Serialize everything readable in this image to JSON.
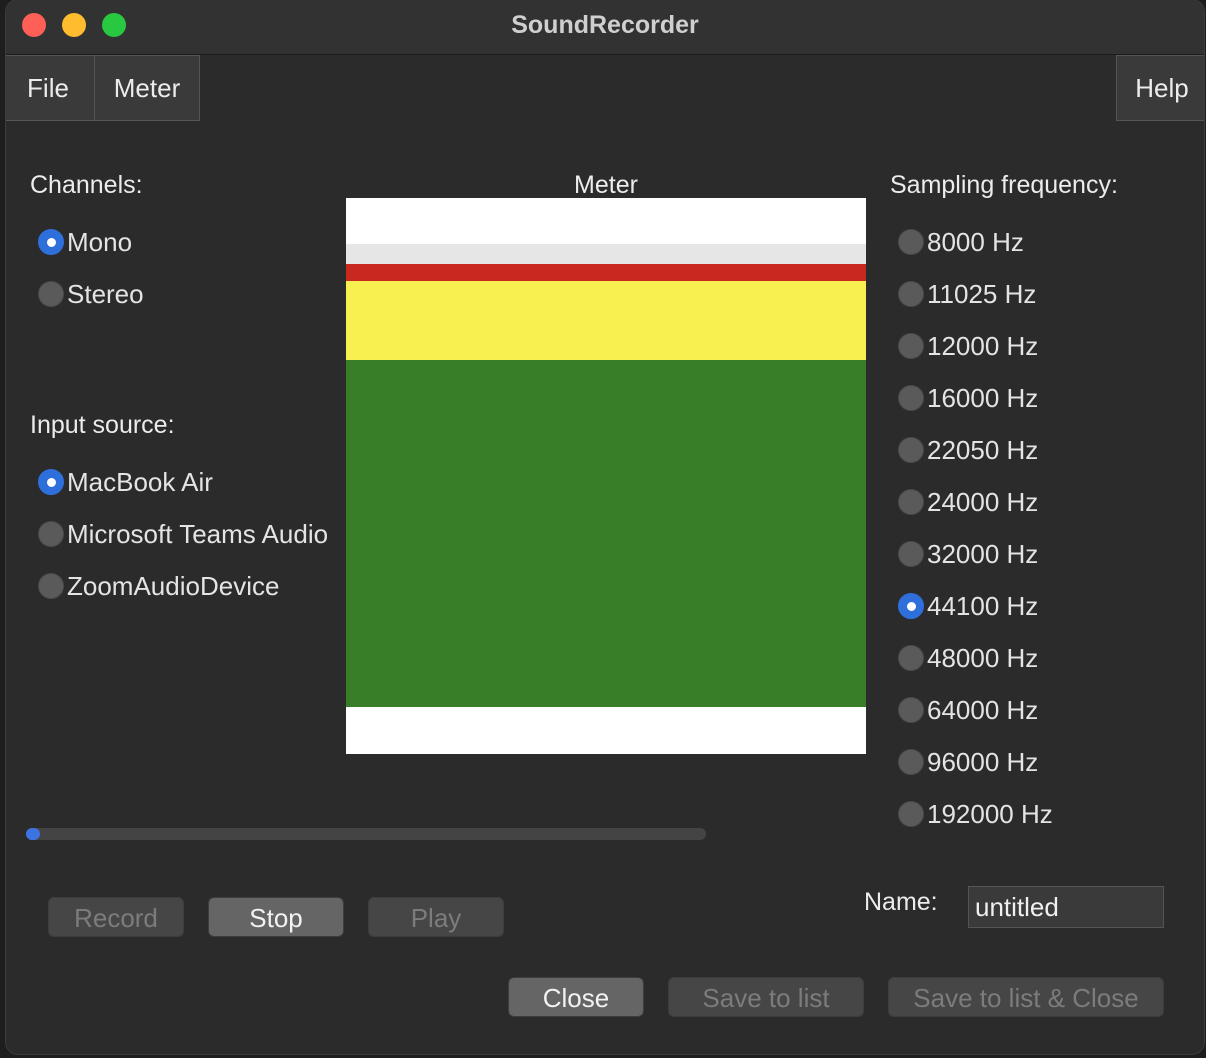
{
  "window": {
    "title": "SoundRecorder"
  },
  "menu": {
    "file": "File",
    "meter": "Meter",
    "help": "Help"
  },
  "channels": {
    "label": "Channels:",
    "options": [
      {
        "label": "Mono",
        "selected": true
      },
      {
        "label": "Stereo",
        "selected": false
      }
    ]
  },
  "input_source": {
    "label": "Input source:",
    "options": [
      {
        "label": "MacBook Air",
        "selected": true
      },
      {
        "label": "Microsoft Teams Audio",
        "selected": false
      },
      {
        "label": "ZoomAudioDevice",
        "selected": false
      }
    ]
  },
  "meter": {
    "label": "Meter",
    "colors": {
      "background": "#ffffff",
      "light": "#e6e6e6",
      "red": "#c8281e",
      "yellow": "#f8f050",
      "green": "#387e29"
    }
  },
  "sampling": {
    "label": "Sampling frequency:",
    "options": [
      {
        "label": "8000 Hz",
        "selected": false
      },
      {
        "label": "11025 Hz",
        "selected": false
      },
      {
        "label": "12000 Hz",
        "selected": false
      },
      {
        "label": "16000 Hz",
        "selected": false
      },
      {
        "label": "22050 Hz",
        "selected": false
      },
      {
        "label": "24000 Hz",
        "selected": false
      },
      {
        "label": "32000 Hz",
        "selected": false
      },
      {
        "label": "44100 Hz",
        "selected": true
      },
      {
        "label": "48000 Hz",
        "selected": false
      },
      {
        "label": "64000 Hz",
        "selected": false
      },
      {
        "label": "96000 Hz",
        "selected": false
      },
      {
        "label": "192000 Hz",
        "selected": false
      }
    ]
  },
  "progress": {
    "fraction": 0.02
  },
  "controls": {
    "record": "Record",
    "stop": "Stop",
    "play": "Play"
  },
  "name": {
    "label": "Name:",
    "value": "untitled"
  },
  "footer": {
    "close": "Close",
    "save_to_list": "Save to list",
    "save_close": "Save to list & Close"
  }
}
